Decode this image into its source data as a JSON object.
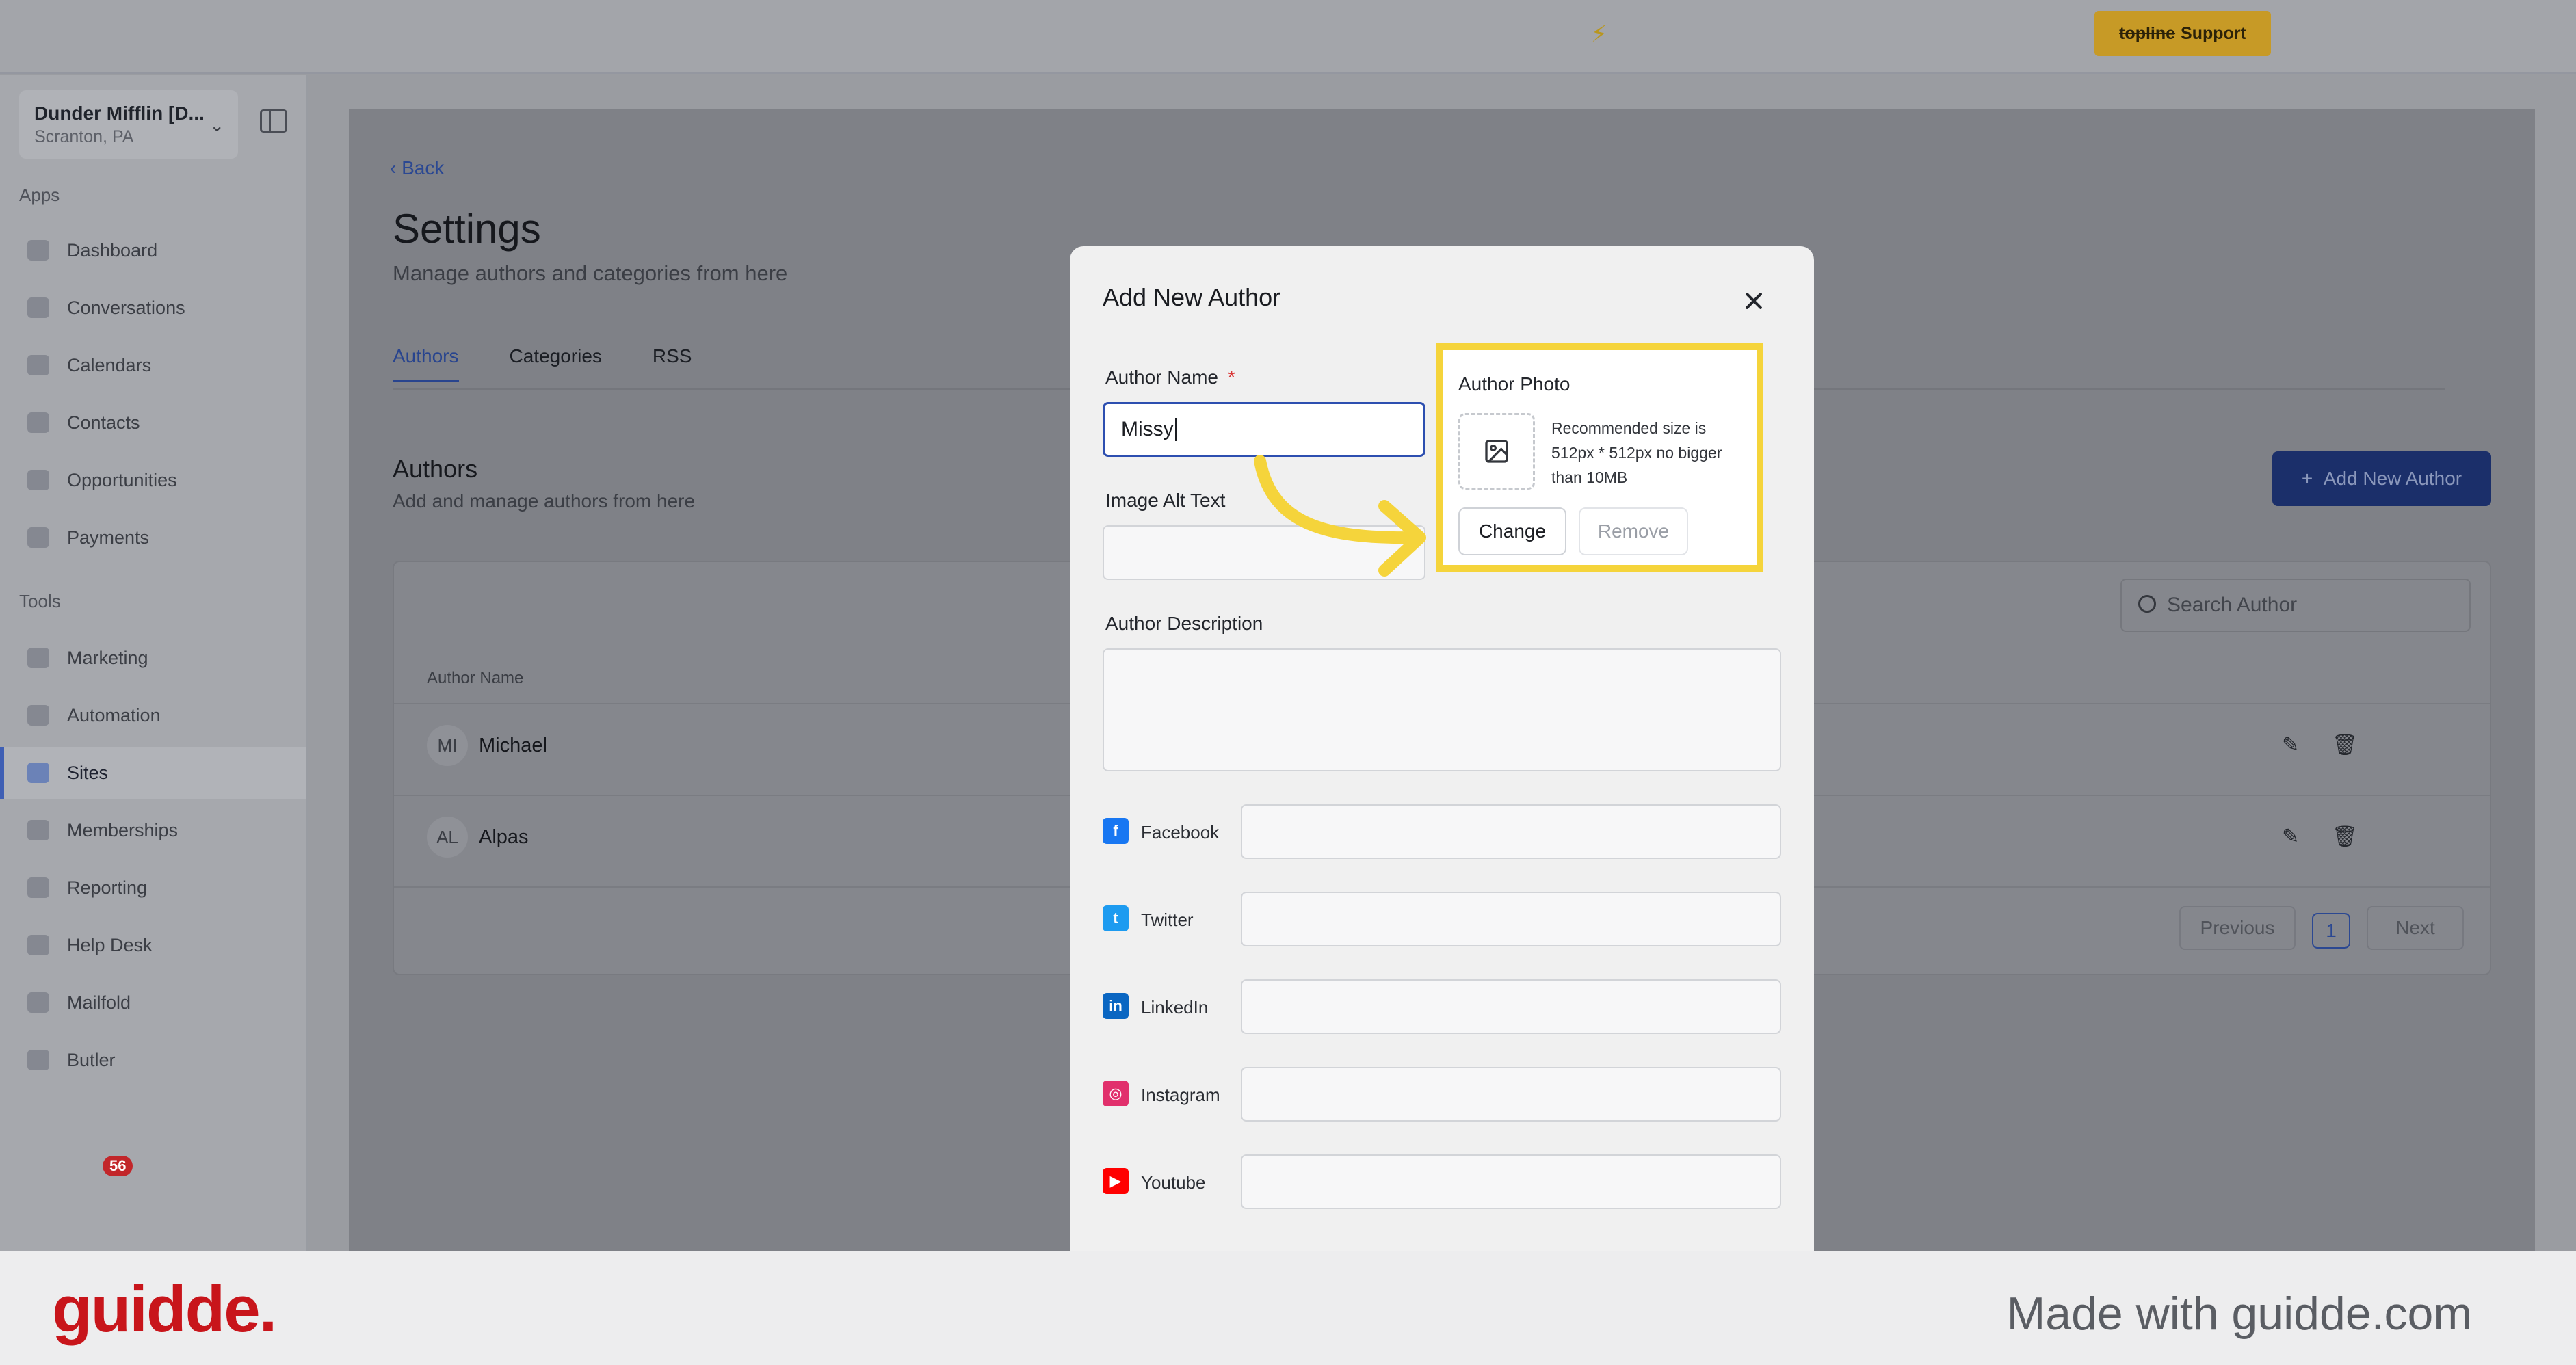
{
  "topbar": {
    "support_strike": "topline",
    "support_label": "Support"
  },
  "sidebar": {
    "account_name": "Dunder Mifflin [D...",
    "account_location": "Scranton, PA",
    "apps_label": "Apps",
    "tools_label": "Tools",
    "apps": [
      "Dashboard",
      "Conversations",
      "Calendars",
      "Contacts",
      "Opportunities",
      "Payments"
    ],
    "tools": [
      "Marketing",
      "Automation",
      "Sites",
      "Memberships",
      "Reporting",
      "Help Desk",
      "Mailfold",
      "Butler"
    ],
    "active_item": "Sites",
    "badge": "56"
  },
  "page": {
    "back": "Back",
    "title": "Settings",
    "subtitle": "Manage authors and categories from here",
    "tabs": [
      "Authors",
      "Categories",
      "RSS"
    ],
    "active_tab": "Authors",
    "section_title": "Authors",
    "section_subtitle": "Add and manage authors from here",
    "add_button": "Add New Author",
    "search_placeholder": "Search Author",
    "column_author": "Author Name",
    "rows": [
      {
        "initials": "MI",
        "name": "Michael"
      },
      {
        "initials": "AL",
        "name": "Alpas"
      }
    ],
    "pager": {
      "previous": "Previous",
      "current": "1",
      "next": "Next"
    }
  },
  "modal": {
    "title": "Add New Author",
    "author_name_label": "Author Name",
    "required_mark": "*",
    "author_name_value": "Missy",
    "alt_text_label": "Image Alt Text",
    "description_label": "Author Description",
    "photo": {
      "title": "Author Photo",
      "hint": "Recommended size is 512px * 512px no bigger than 10MB",
      "change": "Change",
      "remove": "Remove"
    },
    "socials": [
      {
        "label": "Facebook",
        "icon": "facebook-icon",
        "color": "#1877f2"
      },
      {
        "label": "Twitter",
        "icon": "twitter-icon",
        "color": "#1d9bf0"
      },
      {
        "label": "LinkedIn",
        "icon": "linkedin-icon",
        "color": "#0a66c2"
      },
      {
        "label": "Instagram",
        "icon": "instagram-icon",
        "color": "#e1306c"
      },
      {
        "label": "Youtube",
        "icon": "youtube-icon",
        "color": "#ff0000"
      }
    ]
  },
  "highlight_color": "#f5d43b",
  "footer": {
    "brand": "guidde.",
    "made_with": "Made with guidde.com"
  }
}
